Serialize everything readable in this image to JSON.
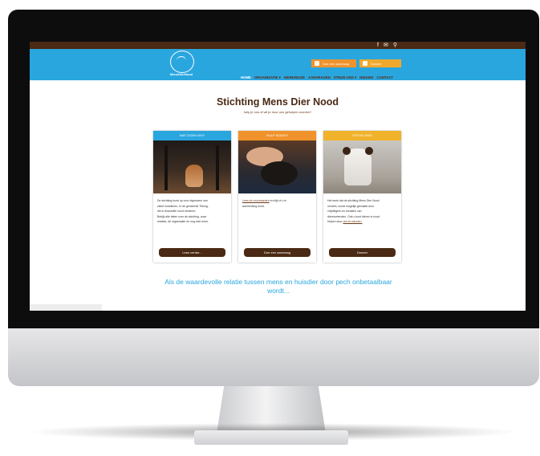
{
  "topbar": {
    "icons": [
      "facebook-icon",
      "mail-icon",
      "search-icon"
    ]
  },
  "header": {
    "logo_text": "MensDierNood",
    "cta_aanvraag": "Doe een aanvraag",
    "cta_doneer": "Doneer",
    "nav": [
      "HOME",
      "ORGANISATIE ▾",
      "WERKWIJZE",
      "AANVRAGEN",
      "STEUN ONS ▾",
      "NIEUWS",
      "CONTACT"
    ]
  },
  "main": {
    "title": "Stichting Mens Dier Nood",
    "subtitle": "help je ons of wil je door ons geholpen worden?",
    "cards": [
      {
        "header": "WAT DOEN WIJ?",
        "lines": [
          "De stichting komt op voor eigenaren van",
          "zieke huisdieren, in de gemeente Tilburg,",
          "die in financiële nood verkeren.",
          "Bekijk alle feiten over de stichting, onze",
          "relaties, de organisatie en nog veel meer."
        ],
        "button": "Lees verder..."
      },
      {
        "header": "HULP NODIG?",
        "link": "Lees de voorwaarden",
        "lines": [
          "en kijk of u in",
          "aanmerking komt."
        ],
        "button": "Doe een aanvraag"
      },
      {
        "header": "STEUN ONS!",
        "lines": [
          "Het werk dat de stichting Mens Dier Nood",
          "verricht, wordt mogelijk gemaakt door",
          "vrijwilligers en donaties van",
          "dierenvrienden. Ook u kunt dieren in nood",
          "helpen door"
        ],
        "link": "ons te steunen.",
        "button": "Doneer"
      }
    ],
    "tagline": "Als de waardevolle relatie tussen mens en huisdier door pech onbetaalbaar wordt..."
  },
  "colors": {
    "brand_blue": "#2aa6df",
    "brand_brown": "#4a2a14",
    "accent_orange": "#f0932c",
    "accent_yellow": "#f0b22a"
  }
}
